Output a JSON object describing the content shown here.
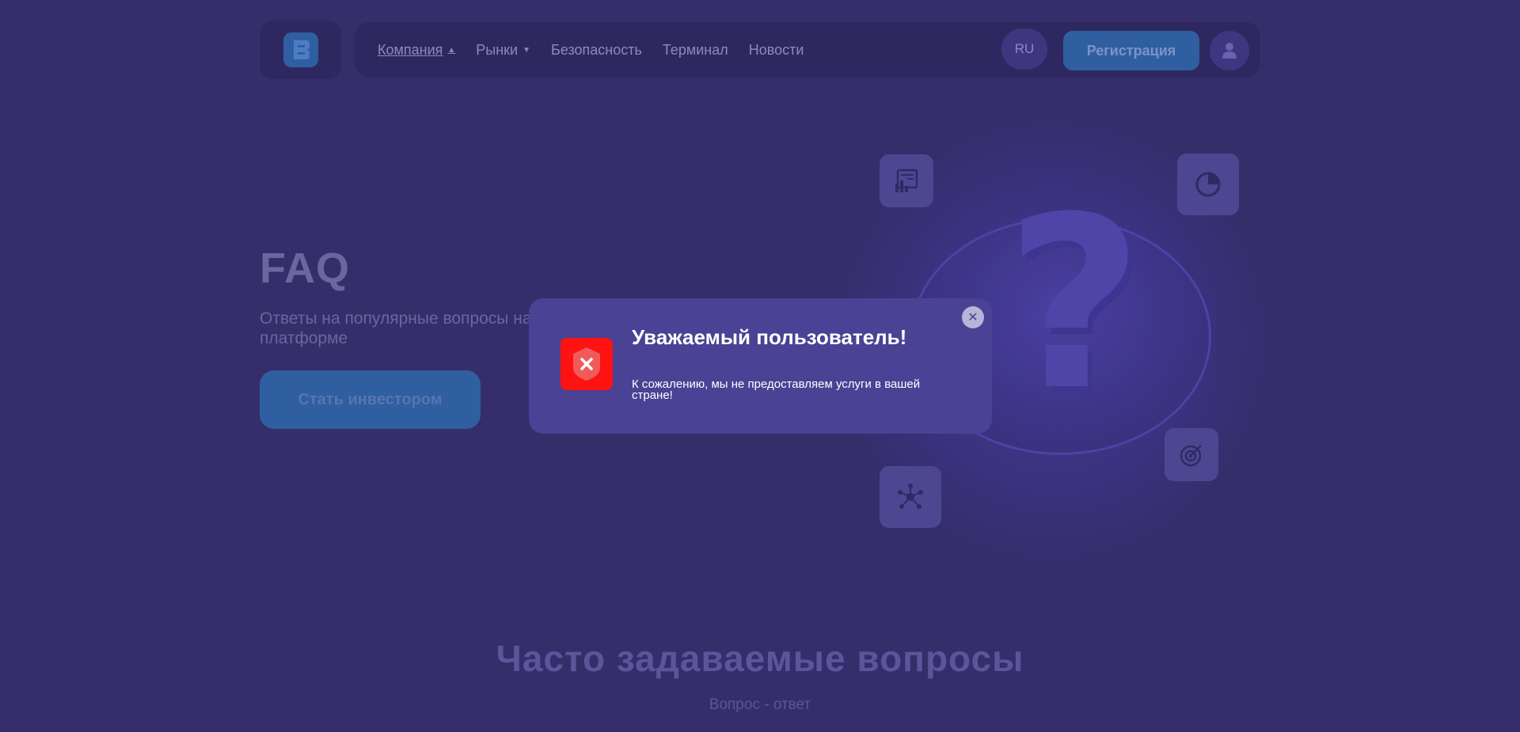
{
  "header": {
    "logo_icon": "brand-logo",
    "nav": [
      {
        "label": "Компания",
        "caret": "▲"
      },
      {
        "label": "Рынки",
        "caret": "▼"
      },
      {
        "label": "Безопасность"
      },
      {
        "label": "Терминал"
      },
      {
        "label": "Новости"
      }
    ],
    "lang": "RU",
    "register_label": "Регистрация",
    "user_icon": "user-icon"
  },
  "hero": {
    "title": "FAQ",
    "subtitle": "Ответы на популярные вопросы на платформе",
    "cta_label": "Стать инвестором",
    "tiles": [
      "report-icon",
      "chart-pie-icon",
      "network-icon",
      "target-icon"
    ]
  },
  "faq": {
    "heading": "Часто задаваемые вопросы",
    "subheading": "Вопрос - ответ"
  },
  "modal": {
    "icon": "shield-x-icon",
    "title": "Уважаемый пользователь!",
    "message": "К сожалению, мы не предоставляем услуги в вашей стране!",
    "close_icon": "close-icon"
  },
  "colors": {
    "background": "#352e6b",
    "modal_bg": "#4a4294",
    "accent_blue": "#2f5fa0",
    "alert_red": "#ff1212"
  }
}
